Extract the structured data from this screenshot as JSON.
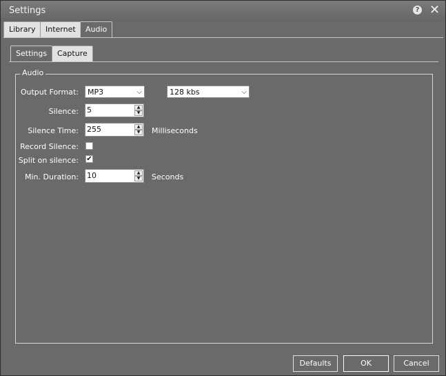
{
  "window": {
    "title": "Settings"
  },
  "top_tabs": [
    {
      "label": "Library"
    },
    {
      "label": "Internet"
    },
    {
      "label": "Audio"
    }
  ],
  "sub_tabs": [
    {
      "label": "Settings"
    },
    {
      "label": "Capture"
    }
  ],
  "audio_group": {
    "legend": "Audio",
    "output_format": {
      "label": "Output Format:",
      "value": "MP3",
      "bitrate": "128 kbs"
    },
    "silence": {
      "label": "Silence:",
      "value": "5"
    },
    "silence_time": {
      "label": "Silence Time:",
      "value": "255",
      "unit": "Milliseconds"
    },
    "record_silence": {
      "label": "Record Silence:",
      "checked": false
    },
    "split_on_silence": {
      "label": "Split on silence:",
      "checked": true,
      "mark": "✔"
    },
    "min_duration": {
      "label": "Min. Duration:",
      "value": "10",
      "unit": "Seconds"
    }
  },
  "buttons": {
    "defaults": "Defaults",
    "ok": "OK",
    "cancel": "Cancel"
  },
  "icons": {
    "help": "?",
    "close": "✕",
    "dropdown": "⌵",
    "spin_up": "▲",
    "spin_down": "▼"
  }
}
